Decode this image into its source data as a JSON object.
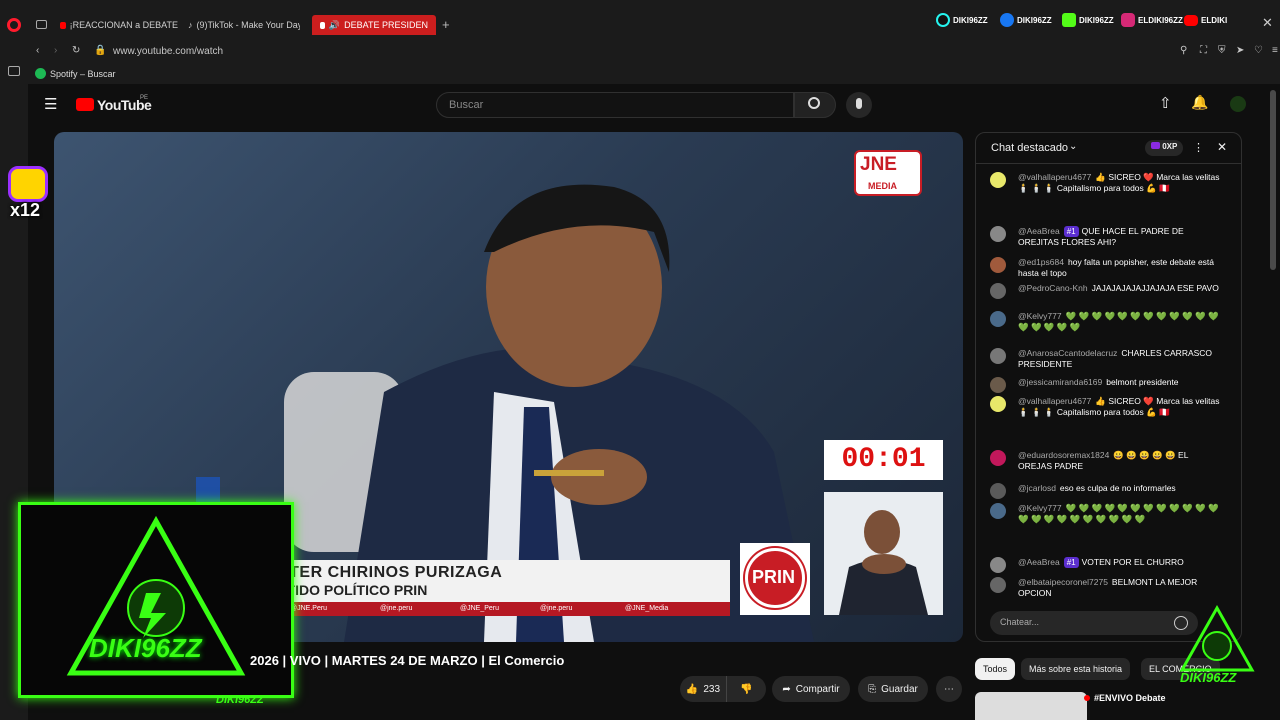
{
  "browser": {
    "tabs": [
      {
        "label": "¡REACCIONAN a DEBATE"
      },
      {
        "label": "(9)TikTok - Make Your Day"
      },
      {
        "label": "DEBATE PRESIDEN"
      }
    ],
    "url": "www.youtube.com/watch",
    "bookmark": "Spotify – Buscar",
    "socials": [
      {
        "handle": "DIKI96ZZ",
        "icon": "tiktok-icon",
        "color": "#25f4ee"
      },
      {
        "handle": "DIKI96ZZ",
        "icon": "facebook-icon",
        "color": "#1877f2"
      },
      {
        "handle": "DIKI96ZZ",
        "icon": "kick-icon",
        "color": "#53fc18"
      },
      {
        "handle": "ELDIKI96ZZ",
        "icon": "instagram-icon",
        "color": "#d62976"
      },
      {
        "handle": "ELDIKI",
        "icon": "youtube-icon",
        "color": "#ff0000"
      }
    ]
  },
  "youtube": {
    "logo": "YouTube",
    "country": "PE",
    "search_placeholder": "Buscar"
  },
  "video": {
    "channel_badge_top": "JNE",
    "channel_badge_bottom": "MEDIA",
    "lower_third_name": "VALTER CHIRINOS PURIZAGA",
    "lower_third_party": "PARTIDO POLÍTICO PRIN",
    "lower_third_socials": [
      "@JNE.Peru",
      "@jne.peru",
      "@JNE_Peru",
      "@jne.peru",
      "@JNE_Media"
    ],
    "timer": "00:01",
    "party_logo": "PRIN",
    "title": "2026 | VIVO | MARTES 24 DE MARZO | El Comercio"
  },
  "actions": {
    "likes": "233",
    "share": "Compartir",
    "save": "Guardar"
  },
  "chat": {
    "header": "Chat destacado",
    "xp": "0XP",
    "input_placeholder": "Chatear...",
    "messages": [
      {
        "author": "@valhallaperu4677",
        "text": "👍 SICREO ❤️ Marca las velitas 🕯️ 🕯️ 🕯️ Capitalismo para todos 💪 🇵🇪"
      },
      {
        "author": "@AeaBrea",
        "badge": "#1",
        "text": "QUE HACE EL PADRE DE OREJITAS FLORES AHI?"
      },
      {
        "author": "@ed1ps684",
        "text": "hoy falta un popisher, este debate está hasta el topo"
      },
      {
        "author": "@PedroCano-Knh",
        "text": "JAJAJAJAJAJJAJAJA ESE PAVO"
      },
      {
        "author": "@Kelvy777",
        "text": "💚 💚 💚 💚 💚 💚 💚 💚 💚 💚 💚 💚 💚 💚 💚 💚 💚"
      },
      {
        "author": "@AnarosaCcantodelacruz",
        "text": "CHARLES CARRASCO PRESIDENTE"
      },
      {
        "author": "@jessicamiranda6169",
        "text": "belmont presidente"
      },
      {
        "author": "@valhallaperu4677",
        "text": "👍 SICREO ❤️ Marca las velitas 🕯️ 🕯️ 🕯️ Capitalismo para todos 💪 🇵🇪"
      },
      {
        "author": "@eduardosoremax1824",
        "text": "😀 😀 😀 😀 😀 EL OREJAS PADRE"
      },
      {
        "author": "@jcarlosd",
        "text": "eso es culpa de no informarles"
      },
      {
        "author": "@Kelvy777",
        "text": "💚 💚 💚 💚 💚 💚 💚 💚 💚 💚 💚 💚 💚 💚 💚 💚 💚 💚 💚 💚 💚 💚"
      },
      {
        "author": "@AeaBrea",
        "badge": "#1",
        "text": "VOTEN POR EL CHURRO"
      },
      {
        "author": "@elbataipecoronel7275",
        "text": "BELMONT LA MEJOR OPCION"
      }
    ]
  },
  "filters": [
    "Todos",
    "Más sobre esta historia",
    "EL COMERCIO"
  ],
  "related_title": "#ENVIVO Debate",
  "overlay": {
    "streamer": "DIKI96ZZ",
    "emote_counter": "x12"
  }
}
